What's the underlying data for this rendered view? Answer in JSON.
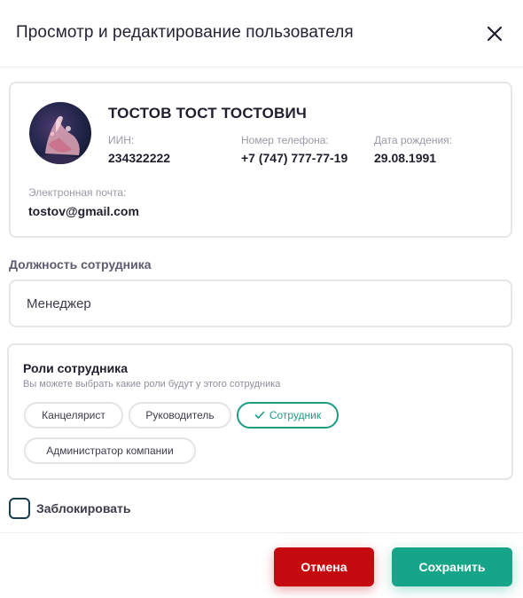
{
  "dialog": {
    "title": "Просмотр и редактирование пользователя",
    "close_icon": "close-icon"
  },
  "profile": {
    "full_name": "ТОСТОВ ТОСТ ТОСТОВИЧ",
    "avatar_icon": "avatar-image",
    "iin_label": "ИИН:",
    "iin_value": "234322222",
    "phone_label": "Номер телефона:",
    "phone_value": "+7 (747) 777-77-19",
    "birth_label": "Дата рождения:",
    "birth_value": "29.08.1991",
    "email_label": "Электронная почта:",
    "email_value": "tostov@gmail.com"
  },
  "position": {
    "label": "Должность сотрудника",
    "value": "Менеджер"
  },
  "roles": {
    "title": "Роли сотрудника",
    "subtitle": "Вы можете выбрать какие роли будут у этого сотрудника",
    "items": [
      {
        "label": "Канцелярист",
        "selected": false
      },
      {
        "label": "Руководитель",
        "selected": false
      },
      {
        "label": "Сотрудник",
        "selected": true
      },
      {
        "label": "Администратор компании",
        "selected": false
      }
    ]
  },
  "block": {
    "label": "Заблокировать",
    "checked": false
  },
  "actions": {
    "cancel_label": "Отмена",
    "save_label": "Сохранить"
  },
  "colors": {
    "accent": "#17a589",
    "danger": "#c40a0e",
    "border": "#e6e6ea"
  }
}
